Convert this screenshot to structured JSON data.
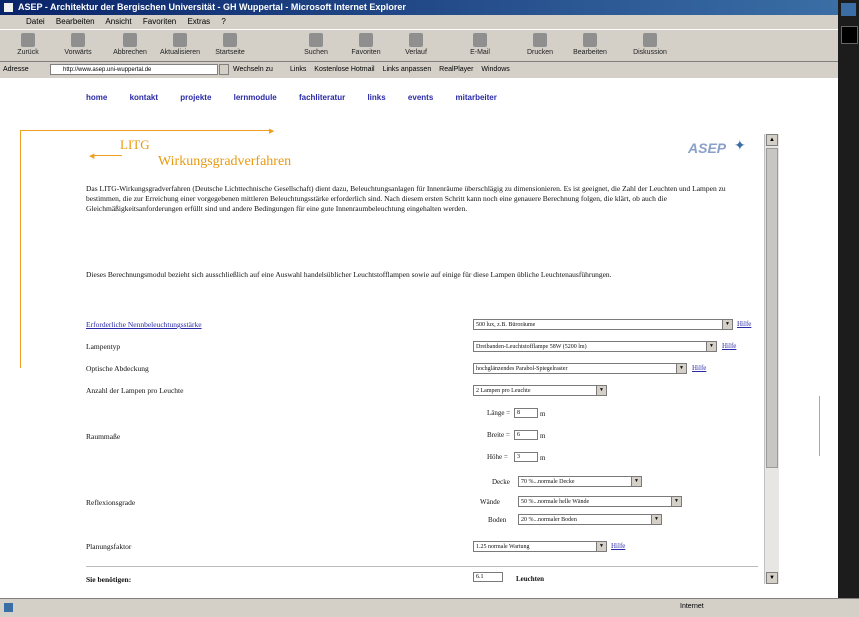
{
  "window": {
    "title": "ASEP - Architektur der Bergischen Universität - GH Wuppertal - Microsoft Internet Explorer"
  },
  "menu": [
    "Datei",
    "Bearbeiten",
    "Ansicht",
    "Favoriten",
    "Extras",
    "?"
  ],
  "toolbar": [
    "Zurück",
    "Vorwärts",
    "Abbrechen",
    "Aktualisieren",
    "Startseite",
    "Suchen",
    "Favoriten",
    "Verlauf",
    "E-Mail",
    "Drucken",
    "Bearbeiten",
    "Diskussion"
  ],
  "address": {
    "label": "Adresse",
    "url": "http://www.asep.uni-wuppertal.de",
    "go": "Wechseln zu",
    "links": [
      "Links",
      "Kostenlose Hotmail",
      "Links anpassen",
      "RealPlayer",
      "Windows"
    ]
  },
  "nav": [
    "home",
    "kontakt",
    "projekte",
    "lernmodule",
    "fachliteratur",
    "links",
    "events",
    "mitarbeiter"
  ],
  "header": {
    "ltg": "LITG",
    "title": "Wirkungsgradverfahren",
    "logo": "ASEP"
  },
  "intro": {
    "p1": "Das LITG-Wirkungsgradverfahren (Deutsche Lichttechnische Gesellschaft) dient dazu, Beleuchtungsanlagen für Innenräume überschlägig zu dimensionieren. Es ist geeignet, die Zahl der Leuchten und Lampen zu bestimmen, die zur Erreichung einer vorgegebenen mittleren Beleuchtungsstärke erforderlich sind. Nach diesem ersten Schritt kann noch eine genauere Berechnung folgen, die klärt, ob auch die Gleichmäßigkeitsanforderungen erfüllt sind und andere Bedingungen für eine gute Innenraumbeleuchtung eingehalten werden.",
    "p2": "Dieses Berechnungsmodul bezieht sich ausschließlich auf eine Auswahl handelsüblicher Leuchtstofflampen sowie auf einige für diese Lampen übliche Leuchtenausführungen."
  },
  "form": {
    "help": "Hilfe",
    "beleuchtung": {
      "label": "Erforderliche Nennbeleuchtungsstärke",
      "value": "500 lux, z.B. Büroräume"
    },
    "lampentyp": {
      "label": "Lampentyp",
      "value": "Dreibanden-Leuchtstofflampe 58W (5200 lm)"
    },
    "abdeckung": {
      "label": "Optische Abdeckung",
      "value": "hochglänzendes Parabol-Spiegelraster"
    },
    "anzahl": {
      "label": "Anzahl der Lampen pro Leuchte",
      "value": "2 Lampen pro Leuchte"
    },
    "raum": {
      "label": "Raummaße",
      "laenge": {
        "label": "Länge =",
        "value": "8",
        "unit": "m"
      },
      "breite": {
        "label": "Breite =",
        "value": "6",
        "unit": "m"
      },
      "hoehe": {
        "label": "Höhe =",
        "value": "3",
        "unit": "m"
      }
    },
    "reflexion": {
      "label": "Reflexionsgrade",
      "decke": {
        "label": "Decke",
        "value": "70 %...normale Decke"
      },
      "waende": {
        "label": "Wände",
        "value": "50 %...normale helle Wände"
      },
      "boden": {
        "label": "Boden",
        "value": "20 %...normaler Boden"
      }
    },
    "planung": {
      "label": "Planungsfaktor",
      "value": "1.25 normale Wartung"
    },
    "result": {
      "label": "Sie benötigen:",
      "value": "6.1",
      "unit": "Leuchten"
    }
  },
  "status": {
    "zone": "Internet"
  }
}
